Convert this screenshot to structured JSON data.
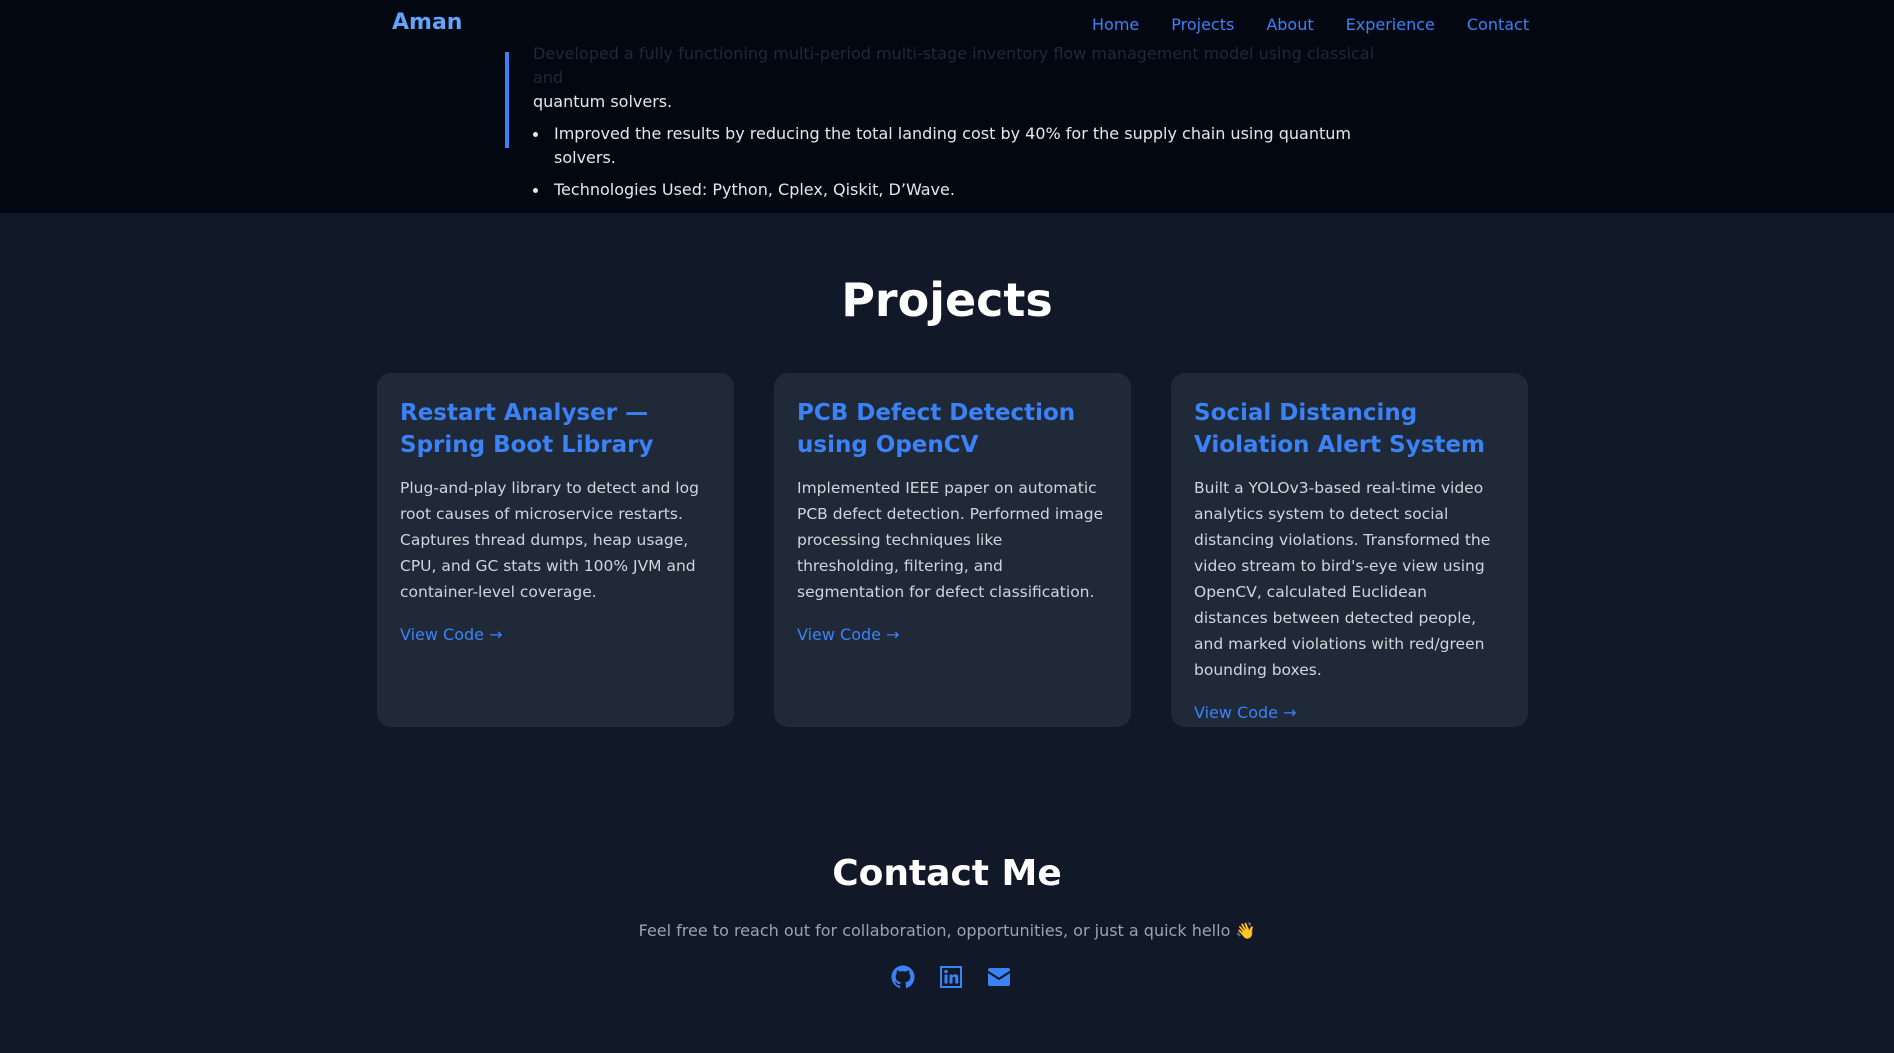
{
  "nav": {
    "brand": "Aman",
    "links": [
      {
        "label": "Home"
      },
      {
        "label": "Projects"
      },
      {
        "label": "About"
      },
      {
        "label": "Experience"
      },
      {
        "label": "Contact"
      }
    ]
  },
  "experience": {
    "bullets": [
      "Developed a fully functioning multi-period multi-stage inventory flow management model using classical and quantum solvers.",
      "Improved the results by reducing the total landing cost by 40% for the supply chain using quantum solvers.",
      "Technologies Used: Python, Cplex, Qiskit, D’Wave."
    ],
    "partial_line_top": "Developed a fully functioning multi-period multi-stage inventory flow management model using classical and",
    "partial_line_bottom": "quantum solvers."
  },
  "projects": {
    "title": "Projects",
    "cards": [
      {
        "title": "Restart Analyser — Spring Boot Library",
        "description": "Plug-and-play library to detect and log root causes of microservice restarts. Captures thread dumps, heap usage, CPU, and GC stats with 100% JVM and container-level coverage.",
        "link": "View Code →"
      },
      {
        "title": "PCB Defect Detection using OpenCV",
        "description": "Implemented IEEE paper on automatic PCB defect detection. Performed image processing techniques like thresholding, filtering, and segmentation for defect classification.",
        "link": "View Code →"
      },
      {
        "title": "Social Distancing Violation Alert System",
        "description": "Built a YOLOv3-based real-time video analytics system to detect social distancing violations. Transformed the video stream to bird's-eye view using OpenCV, calculated Euclidean distances between detected people, and marked violations with red/green bounding boxes.",
        "link": "View Code →"
      }
    ]
  },
  "contact": {
    "title": "Contact Me",
    "subtitle": "Feel free to reach out for collaboration, opportunities, or just a quick hello 👋",
    "socials": [
      {
        "icon": "github-icon"
      },
      {
        "icon": "linkedin-icon"
      },
      {
        "icon": "mail-icon"
      }
    ]
  },
  "colors": {
    "accent": "#3b82f6",
    "brand": "#60a5fa",
    "bg_top": "#030712",
    "bg_main": "#111827",
    "card": "#1f2937"
  }
}
